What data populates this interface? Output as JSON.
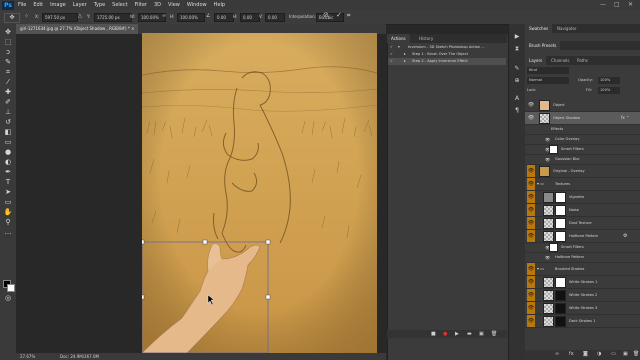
{
  "app": {
    "logo": "Ps"
  },
  "menu": [
    "File",
    "Edit",
    "Image",
    "Layer",
    "Type",
    "Select",
    "Filter",
    "3D",
    "View",
    "Window",
    "Help"
  ],
  "window_controls": {
    "minimize": "—",
    "maximize": "□",
    "close": "✕"
  },
  "options": {
    "x": "597.50 px",
    "y": "1725.00 px",
    "w": "100.00%",
    "h": "100.00%",
    "angle": "0.00",
    "h_skew": "0.00",
    "v_skew": "0.00",
    "interpolation_label": "Interpolation:",
    "interpolation_value": "Bicubic",
    "cancel": "⊘",
    "commit": "✓"
  },
  "document": {
    "tab_title": "girl-1271634.jpg @ 27.7% (Object Shadow , RGB/8#) *",
    "tab_close": "×",
    "zoom": "27.67%",
    "doc_size": "Doc: 24.9M/367.0M"
  },
  "actions_panel": {
    "tabs": [
      "Actions",
      "History"
    ],
    "rows": [
      {
        "label": "Inversium - 3D Sketch Photoshop Action ...",
        "selected": false
      },
      {
        "label": "Step 1 - Brush Over The Object",
        "selected": false
      },
      {
        "label": "Step 2 - Apply Inversium Effect",
        "selected": true
      }
    ],
    "footer_icons": [
      "■",
      "●",
      "▶",
      "▬",
      "▣",
      "🗑"
    ]
  },
  "swatches_tabs": [
    "Swatches",
    "Navigator"
  ],
  "brush_presets_tab": "Brush Presets",
  "layers_tabs": [
    "Layers",
    "Channels",
    "Paths"
  ],
  "layers_controls": {
    "kind": "Kind",
    "blend": "Normal",
    "opacity_label": "Opacity:",
    "opacity": "100%",
    "fill_label": "Fill:",
    "fill": "100%",
    "lock_label": "Lock:"
  },
  "layers": [
    {
      "name": "Object",
      "selected": false,
      "orange": false,
      "kind": "normal"
    },
    {
      "name": "Object Shadow",
      "selected": true,
      "orange": false,
      "kind": "normal"
    },
    {
      "name": "Effects",
      "selected": false,
      "orange": false,
      "kind": "sub"
    },
    {
      "name": "Color Overlay",
      "selected": false,
      "orange": false,
      "kind": "sub"
    },
    {
      "name": "Smart Filters",
      "selected": false,
      "orange": false,
      "kind": "sub"
    },
    {
      "name": "Gaussian Blur",
      "selected": false,
      "orange": false,
      "kind": "sub"
    },
    {
      "name": "Original - Overlay",
      "selected": false,
      "orange": true,
      "kind": "normal"
    },
    {
      "name": "Textures",
      "selected": false,
      "orange": true,
      "kind": "group"
    },
    {
      "name": "Vignette",
      "selected": false,
      "orange": true,
      "kind": "normal"
    },
    {
      "name": "Noise",
      "selected": false,
      "orange": true,
      "kind": "normal"
    },
    {
      "name": "Dust Texture",
      "selected": false,
      "orange": true,
      "kind": "normal"
    },
    {
      "name": "Halftone Pattern",
      "selected": false,
      "orange": true,
      "kind": "normal"
    },
    {
      "name": "Smart Filters",
      "selected": false,
      "orange": false,
      "kind": "sub"
    },
    {
      "name": "Halftone Pattern",
      "selected": false,
      "orange": false,
      "kind": "sub"
    },
    {
      "name": "Brushed Strokes",
      "selected": false,
      "orange": true,
      "kind": "group"
    },
    {
      "name": "White Strokes 1",
      "selected": false,
      "orange": true,
      "kind": "normal"
    },
    {
      "name": "White Strokes 2",
      "selected": false,
      "orange": true,
      "kind": "normal"
    },
    {
      "name": "White Strokes 3",
      "selected": false,
      "orange": true,
      "kind": "normal"
    },
    {
      "name": "Dark Strokes 1",
      "selected": false,
      "orange": true,
      "kind": "normal"
    }
  ],
  "colors": {
    "accent_orange": "#b8780d",
    "panel": "#3b3b3b",
    "image": "#d4a656"
  }
}
